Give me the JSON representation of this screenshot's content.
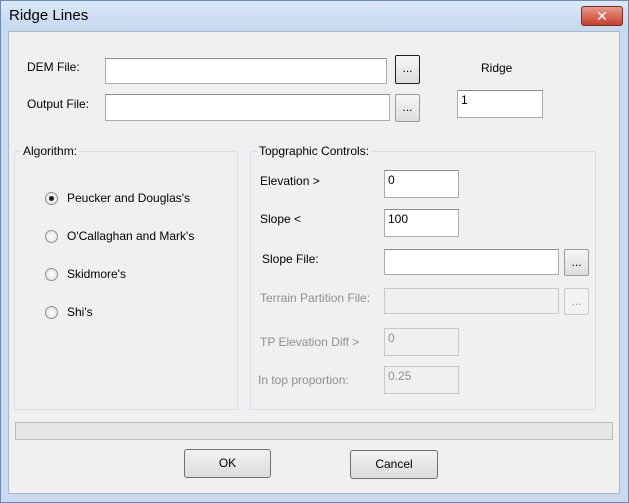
{
  "window": {
    "title": "Ridge Lines",
    "close_symbol": "✕"
  },
  "files": {
    "dem_label": "DEM File:",
    "dem_value": "",
    "dem_browse": "...",
    "output_label": "Output File:",
    "output_value": "",
    "output_browse": "..."
  },
  "ridge": {
    "label": "Ridge",
    "value": "1"
  },
  "algorithm": {
    "title": "Algorithm:",
    "options": [
      {
        "label": "Peucker and Douglas's",
        "checked": true
      },
      {
        "label": "O'Callaghan and Mark's",
        "checked": false
      },
      {
        "label": "Skidmore's",
        "checked": false
      },
      {
        "label": "Shi's",
        "checked": false
      }
    ]
  },
  "topographic": {
    "title": "Topgraphic Controls:",
    "elevation_label": "Elevation >",
    "elevation_value": "0",
    "slope_label": "Slope <",
    "slope_value": "100",
    "slope_file_label": "Slope File:",
    "slope_file_value": "",
    "slope_file_browse": "...",
    "terrain_label": "Terrain Partition File:",
    "terrain_value": "",
    "terrain_browse": "...",
    "tp_elev_label": "TP Elevation Diff >",
    "tp_elev_value": "0",
    "in_top_label": "In top proportion:",
    "in_top_value": "0.25"
  },
  "progress": {
    "value": 0
  },
  "buttons": {
    "ok": "OK",
    "cancel": "Cancel"
  }
}
